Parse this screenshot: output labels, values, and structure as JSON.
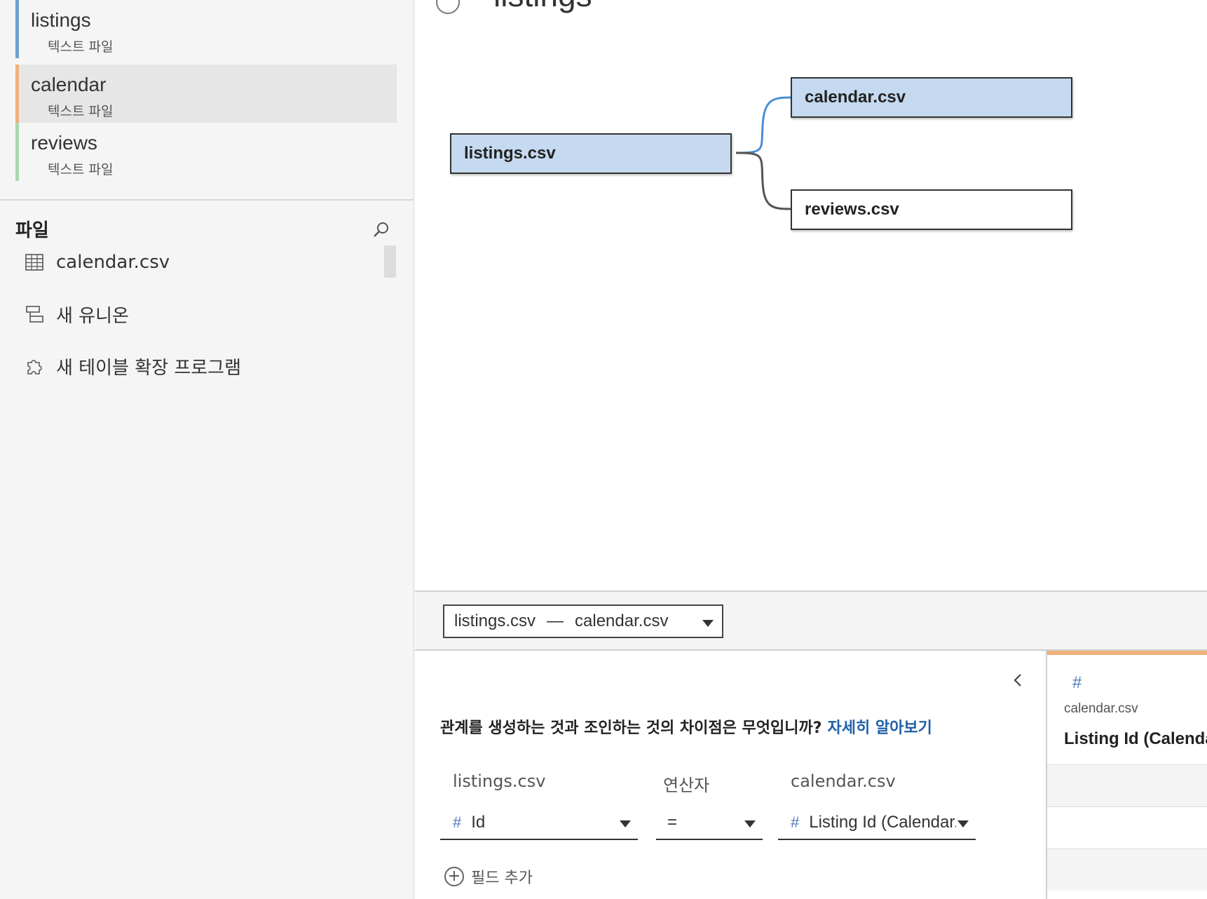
{
  "sidebar": {
    "datasources": [
      {
        "name": "listings",
        "sub": "텍스트 파일",
        "color": "#6fa0c9"
      },
      {
        "name": "calendar",
        "sub": "텍스트 파일",
        "color": "#f0b07a"
      },
      {
        "name": "reviews",
        "sub": "텍스트 파일",
        "color": "#a9d6b0"
      }
    ],
    "files_header": "파일",
    "file_items": [
      {
        "label": "calendar.csv",
        "icon": "table-icon"
      },
      {
        "label": "새 유니온",
        "icon": "union-icon"
      },
      {
        "label": "새 테이블 확장 프로그램",
        "icon": "extension-icon"
      }
    ]
  },
  "canvas": {
    "title": "listings",
    "nodes": {
      "listings": "listings.csv",
      "calendar": "calendar.csv",
      "reviews": "reviews.csv"
    }
  },
  "relationship_bar": {
    "left": "listings.csv",
    "separator": "—",
    "right": "calendar.csv"
  },
  "relationship_panel": {
    "help_text": "관계를 생성하는 것과 조인하는 것의 차이점은 무엇입니까?",
    "help_link": "자세히 알아보기",
    "headers": {
      "left": "listings.csv",
      "operator": "연산자",
      "right": "calendar.csv"
    },
    "left_field": "Id",
    "operator": "=",
    "right_field": "Listing Id (Calendar.csv)",
    "add_field": "필드 추가"
  },
  "preview": {
    "source": "calendar.csv",
    "field": "Listing Id (Calendar.csv)"
  },
  "colors": {
    "node_fill": "#c5daf0",
    "link_blue": "#4a8fd4",
    "link_gray": "#555555",
    "help_link": "#1f5fa8"
  }
}
